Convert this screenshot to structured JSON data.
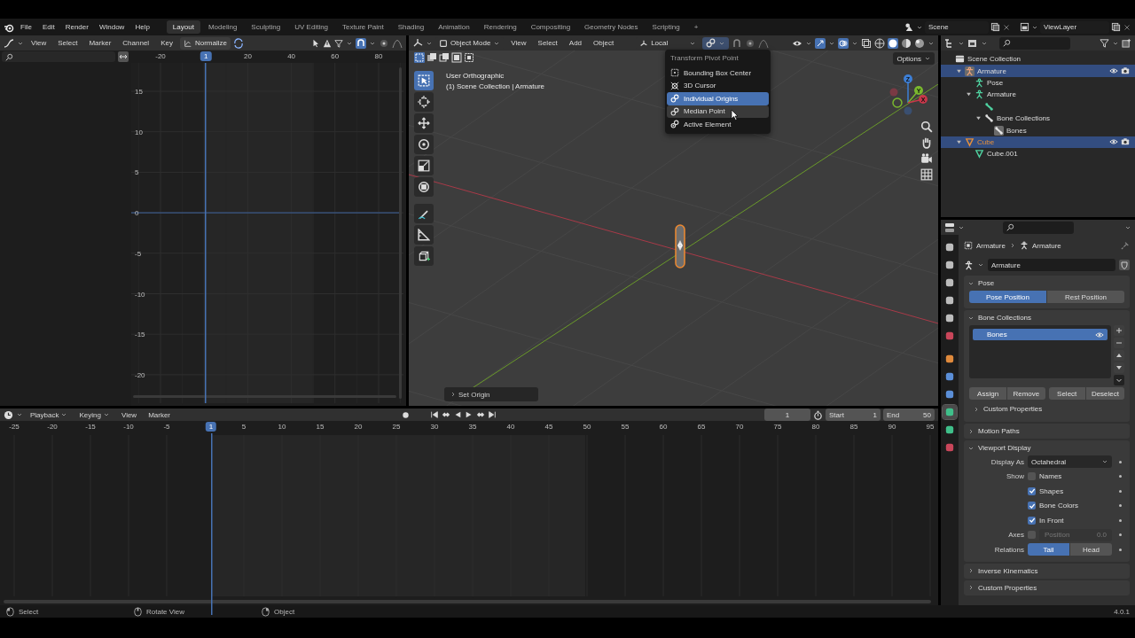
{
  "top_bar": {
    "menus": [
      "File",
      "Edit",
      "Render",
      "Window",
      "Help"
    ],
    "workspaces": [
      {
        "label": "Layout",
        "selected": true
      },
      {
        "label": "Modeling",
        "selected": false
      },
      {
        "label": "Sculpting",
        "selected": false
      },
      {
        "label": "UV Editing",
        "selected": false
      },
      {
        "label": "Texture Paint",
        "selected": false
      },
      {
        "label": "Shading",
        "selected": false
      },
      {
        "label": "Animation",
        "selected": false
      },
      {
        "label": "Rendering",
        "selected": false
      },
      {
        "label": "Compositing",
        "selected": false
      },
      {
        "label": "Geometry Nodes",
        "selected": false
      },
      {
        "label": "Scripting",
        "selected": false
      }
    ],
    "add_workspace": "+",
    "scene": "Scene",
    "view_layer": "ViewLayer"
  },
  "graph_editor": {
    "menus": [
      "View",
      "Select",
      "Marker",
      "Channel",
      "Key"
    ],
    "normalize": "Normalize",
    "frame_ticks": [
      "-20",
      "20",
      "40",
      "60",
      "80"
    ],
    "current_frame": "1",
    "value_ticks": [
      "15",
      "10",
      "5",
      "0",
      "-5",
      "-10",
      "-15",
      "-20"
    ]
  },
  "viewport": {
    "mode": "Object Mode",
    "menus": [
      "View",
      "Select",
      "Add",
      "Object"
    ],
    "orientation": "Local",
    "options": "Options",
    "view_name": "User Orthographic",
    "context": "(1) Scene Collection | Armature",
    "last_operator": "Set Origin",
    "tools": [
      {
        "kind": "select",
        "selected": true
      },
      {
        "kind": "cursor",
        "selected": false
      },
      {
        "kind": "move",
        "selected": false
      },
      {
        "kind": "rotate",
        "selected": false
      },
      {
        "kind": "scale",
        "selected": false
      },
      {
        "kind": "transform",
        "selected": false
      },
      {
        "kind": "annotate",
        "selected": false
      },
      {
        "kind": "measure",
        "selected": false
      },
      {
        "kind": "add",
        "selected": false
      }
    ],
    "gizmo_axes": [
      "X",
      "Y",
      "Z"
    ],
    "pivot_menu": {
      "title": "Transform Pivot Point",
      "items": [
        {
          "label": "Bounding Box Center",
          "kind": "bounds",
          "selected": false,
          "hovered": false
        },
        {
          "label": "3D Cursor",
          "kind": "cursor",
          "selected": false,
          "hovered": false
        },
        {
          "label": "Individual Origins",
          "kind": "individual",
          "selected": true,
          "hovered": false
        },
        {
          "label": "Median Point",
          "kind": "median",
          "selected": false,
          "hovered": true
        },
        {
          "label": "Active Element",
          "kind": "active",
          "selected": false,
          "hovered": false
        }
      ]
    }
  },
  "outliner": {
    "tree": [
      {
        "label": "Scene Collection",
        "kind": "collection",
        "selected": false,
        "children": [
          {
            "label": "Armature",
            "kind": "armature_object",
            "selected": true,
            "expanded": true,
            "children": [
              {
                "label": "Pose",
                "kind": "pose",
                "selected": false
              },
              {
                "label": "Armature",
                "kind": "armature_data",
                "selected": false,
                "expanded": true,
                "children": [
                  {
                    "kind": "bone",
                    "selected": false
                  },
                  {
                    "label": "Bone Collections",
                    "kind": "bone_collections",
                    "selected": false,
                    "expanded": true,
                    "children": [
                      {
                        "label": "Bones",
                        "kind": "bone_collection",
                        "selected": false
                      }
                    ]
                  }
                ]
              }
            ]
          },
          {
            "label": "Cube",
            "kind": "mesh_object",
            "selected": true,
            "expanded": true,
            "children": [
              {
                "label": "Cube.001",
                "kind": "mesh_data",
                "selected": false
              }
            ]
          }
        ]
      }
    ]
  },
  "properties": {
    "tabs": [
      {
        "color": "#bdbdbd",
        "selected": false
      },
      {
        "color": "#bdbdbd",
        "selected": false
      },
      {
        "color": "#bdbdbd",
        "selected": false
      },
      {
        "color": "#bdbdbd",
        "selected": false
      },
      {
        "color": "#bdbdbd",
        "selected": false
      },
      {
        "color": "#c9465a",
        "selected": false
      },
      {
        "color": "#e08a3c",
        "selected": false
      },
      {
        "color": "#5b8fd8",
        "selected": false
      },
      {
        "color": "#5b8fd8",
        "selected": false
      },
      {
        "color": "#3fbf8a",
        "selected": true
      },
      {
        "color": "#3fbf8a",
        "selected": false
      },
      {
        "color": "#c9465a",
        "selected": false
      }
    ],
    "breadcrumb": [
      "Armature",
      "Armature"
    ],
    "data_name": "Armature",
    "panels": [
      {
        "kind": "pose",
        "title": "Pose",
        "expanded": true,
        "options": [
          {
            "label": "Pose Position",
            "selected": true
          },
          {
            "label": "Rest Position",
            "selected": false
          }
        ]
      },
      {
        "kind": "bone_collections",
        "title": "Bone Collections",
        "expanded": true,
        "items": [
          {
            "label": "Bones",
            "selected": true
          }
        ],
        "buttons": [
          "Assign",
          "Remove",
          "Select",
          "Deselect"
        ],
        "subpanel": {
          "title": "Custom Properties",
          "expanded": false
        }
      },
      {
        "kind": "plain",
        "title": "Motion Paths",
        "expanded": false
      },
      {
        "kind": "viewport_display",
        "title": "Viewport Display",
        "expanded": true,
        "display_as_label": "Display As",
        "display_as": "Octahedral",
        "show_label": "Show",
        "show": [
          {
            "label": "Names",
            "checked": false
          },
          {
            "label": "Shapes",
            "checked": true
          },
          {
            "label": "Bone Colors",
            "checked": true
          },
          {
            "label": "In Front",
            "checked": true
          }
        ],
        "axes_label": "Axes",
        "axes": {
          "checked": false,
          "field_label": "Position",
          "field_value": "0.0",
          "disabled": true
        },
        "relations_label": "Relations",
        "relations": [
          {
            "label": "Tail",
            "selected": true
          },
          {
            "label": "Head",
            "selected": false
          }
        ]
      },
      {
        "kind": "plain",
        "title": "Inverse Kinematics",
        "expanded": false
      },
      {
        "kind": "plain",
        "title": "Custom Properties",
        "expanded": false
      }
    ]
  },
  "timeline": {
    "menus": [
      "Playback",
      "Keying",
      "View",
      "Marker"
    ],
    "current_frame": "1",
    "frame_field": "1",
    "start_label": "Start",
    "start": "1",
    "end_label": "End",
    "end": "50",
    "ticks": [
      "-25",
      "-20",
      "-15",
      "-10",
      "-5",
      "5",
      "10",
      "15",
      "20",
      "25",
      "30",
      "35",
      "40",
      "45",
      "50",
      "55",
      "60",
      "65",
      "70",
      "75",
      "80",
      "85",
      "90",
      "95"
    ]
  },
  "status_bar": {
    "hints": [
      {
        "kind": "left",
        "label": "Select"
      },
      {
        "kind": "middle",
        "label": "Rotate View"
      },
      {
        "kind": "right",
        "label": "Object"
      }
    ],
    "version": "4.0.1"
  }
}
